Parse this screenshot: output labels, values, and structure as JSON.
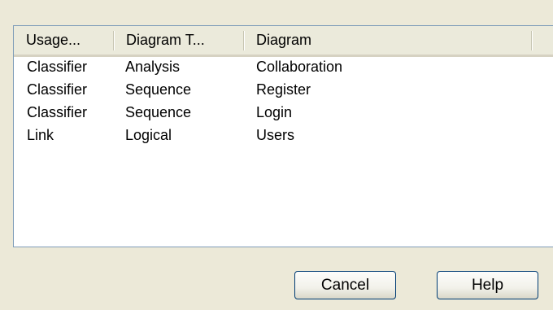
{
  "list": {
    "columns": [
      "Usage...",
      "Diagram T...",
      "Diagram"
    ],
    "rows": [
      [
        "Classifier",
        "Analysis",
        "Collaboration"
      ],
      [
        "Classifier",
        "Sequence",
        "Register"
      ],
      [
        "Classifier",
        "Sequence",
        "Login"
      ],
      [
        "Link",
        "Logical",
        "Users"
      ]
    ]
  },
  "buttons": {
    "cancel": "Cancel",
    "help": "Help"
  }
}
